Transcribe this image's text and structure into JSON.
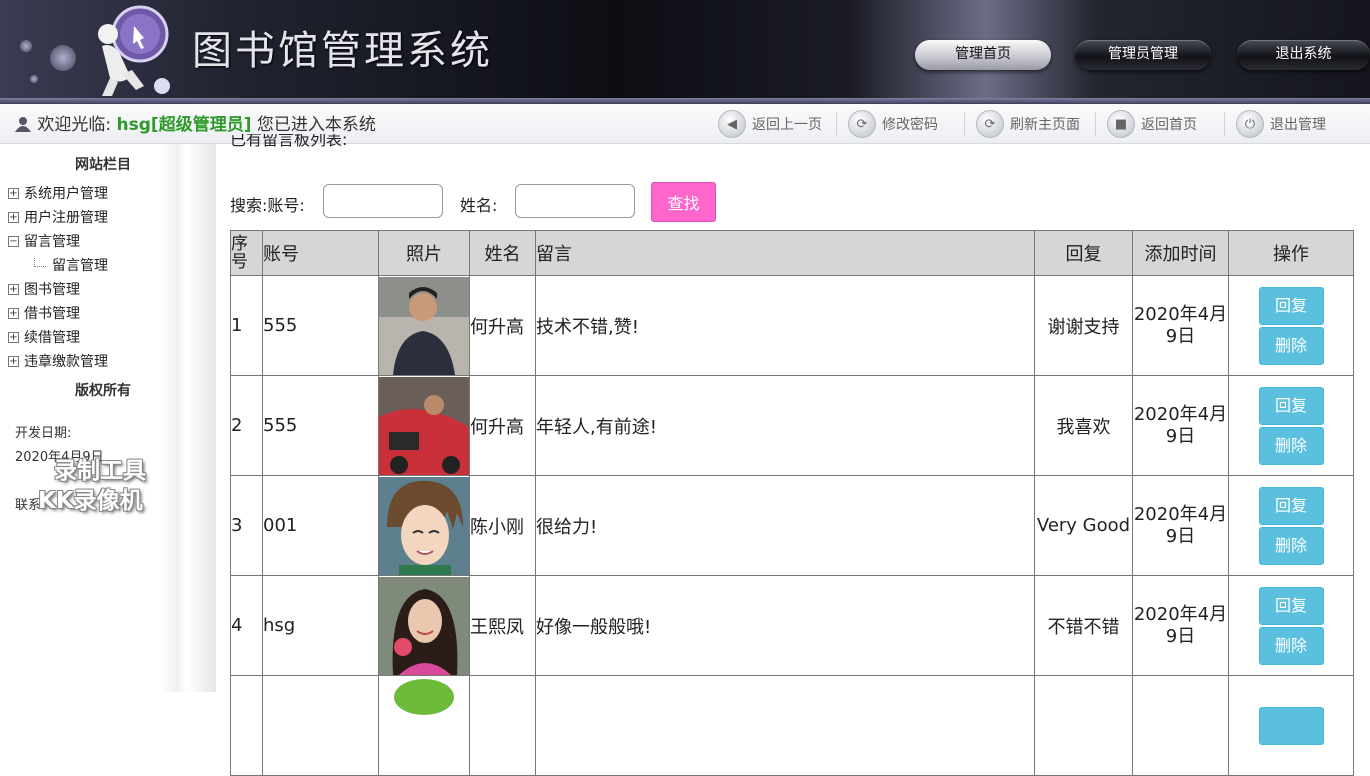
{
  "header": {
    "title": "图书馆管理系统",
    "nav": [
      "管理首页",
      "管理员管理",
      "退出系统"
    ]
  },
  "toolbar": {
    "welcome_prefix": "欢迎光临:",
    "user": "hsg[超级管理员]",
    "welcome_suffix": "您已进入本系统",
    "tools": [
      {
        "label": "返回上一页",
        "icon": "back-arrow-icon"
      },
      {
        "label": "修改密码",
        "icon": "lock-icon"
      },
      {
        "label": "刷新主页面",
        "icon": "refresh-icon"
      },
      {
        "label": "返回首页",
        "icon": "home-icon"
      },
      {
        "label": "退出管理",
        "icon": "power-icon"
      }
    ]
  },
  "sidebar": {
    "title": "网站栏目",
    "items": [
      {
        "label": "系统用户管理",
        "expanded": false
      },
      {
        "label": "用户注册管理",
        "expanded": false
      },
      {
        "label": "留言管理",
        "expanded": true
      },
      {
        "label": "留言管理",
        "child": true
      },
      {
        "label": "图书管理",
        "expanded": false
      },
      {
        "label": "借书管理",
        "expanded": false
      },
      {
        "label": "续借管理",
        "expanded": false
      },
      {
        "label": "违章缴款管理",
        "expanded": false
      }
    ],
    "copyright_title": "版权所有",
    "dev_date_label": "开发日期:",
    "dev_date": "2020年4月9日",
    "contact_label": "联系"
  },
  "watermark": {
    "line1": "录制工具",
    "line2": "KK录像机"
  },
  "main": {
    "list_title": "已有留言板列表:",
    "search": {
      "account_label": "搜索:账号:",
      "account_value": "",
      "name_label": "姓名:",
      "name_value": "",
      "button": "查找"
    },
    "columns": [
      "序号",
      "账号",
      "照片",
      "姓名",
      "留言",
      "回复",
      "添加时间",
      "操作"
    ],
    "rows": [
      {
        "idx": "1",
        "account": "555",
        "name": "何升高",
        "message": "技术不错,赞!",
        "reply": "谢谢支持",
        "time": "2020年4月9日"
      },
      {
        "idx": "2",
        "account": "555",
        "name": "何升高",
        "message": "年轻人,有前途!",
        "reply": "我喜欢",
        "time": "2020年4月9日"
      },
      {
        "idx": "3",
        "account": "001",
        "name": "陈小刚",
        "message": "很给力!",
        "reply": "Very Good",
        "time": "2020年4月9日"
      },
      {
        "idx": "4",
        "account": "hsg",
        "name": "王熙凤",
        "message": "好像一般般哦!",
        "reply": "不错不错",
        "time": "2020年4月9日"
      }
    ],
    "actions": {
      "reply": "回复",
      "delete": "删除"
    }
  }
}
